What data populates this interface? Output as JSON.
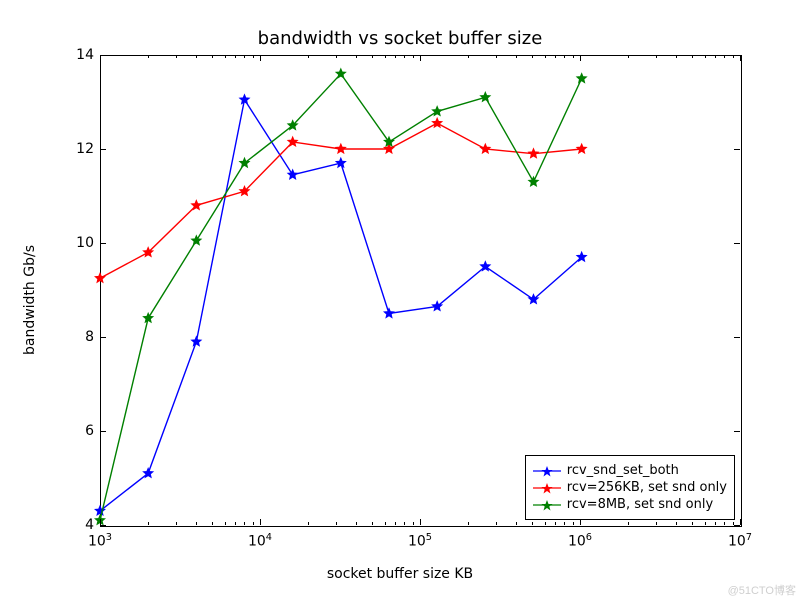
{
  "chart_data": {
    "type": "line",
    "title": "bandwidth vs socket buffer size",
    "xlabel": "socket buffer size KB",
    "ylabel": "bandwidth Gb/s",
    "xscale": "log",
    "xlim": [
      1000,
      10000000
    ],
    "ylim": [
      4,
      14
    ],
    "xticks": [
      1000,
      10000,
      100000,
      1000000,
      10000000
    ],
    "xtick_labels": [
      "10^3",
      "10^4",
      "10^5",
      "10^6",
      "10^7"
    ],
    "yticks": [
      4,
      6,
      8,
      10,
      12,
      14
    ],
    "x": [
      1000,
      2000,
      4000,
      8000,
      16000,
      32000,
      64000,
      128000,
      256000,
      512000,
      1024000
    ],
    "series": [
      {
        "name": "rcv_snd_set_both",
        "color": "#0000ff",
        "values": [
          4.3,
          5.1,
          7.9,
          13.05,
          11.45,
          11.7,
          8.5,
          8.65,
          9.5,
          8.8,
          9.7
        ]
      },
      {
        "name": "rcv=256KB, set snd only",
        "color": "#ff0000",
        "values": [
          9.25,
          9.8,
          10.8,
          11.1,
          12.15,
          12.0,
          12.0,
          12.55,
          12.0,
          11.9,
          12.0
        ]
      },
      {
        "name": "rcv=8MB, set snd only",
        "color": "#008000",
        "values": [
          4.1,
          8.4,
          10.05,
          11.7,
          12.5,
          13.6,
          12.15,
          12.8,
          13.1,
          11.3,
          13.5
        ]
      }
    ]
  },
  "watermark": "@51CTO博客"
}
